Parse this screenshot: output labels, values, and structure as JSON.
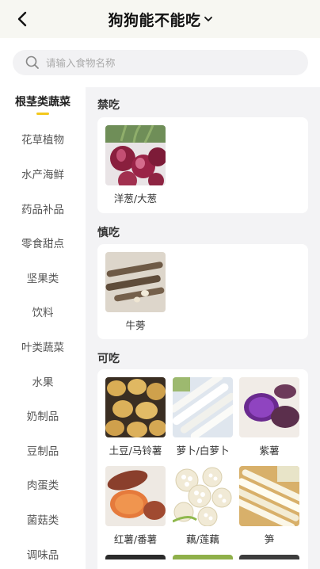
{
  "header": {
    "title": "狗狗能不能吃"
  },
  "search": {
    "placeholder": "请输入食物名称"
  },
  "sidebar": {
    "items": [
      {
        "label": "根茎类蔬菜",
        "active": true
      },
      {
        "label": "花草植物"
      },
      {
        "label": "水产海鲜"
      },
      {
        "label": "药品补品"
      },
      {
        "label": "零食甜点"
      },
      {
        "label": "坚果类"
      },
      {
        "label": "饮料"
      },
      {
        "label": "叶类蔬菜"
      },
      {
        "label": "水果"
      },
      {
        "label": "奶制品"
      },
      {
        "label": "豆制品"
      },
      {
        "label": "肉蛋类"
      },
      {
        "label": "菌菇类"
      },
      {
        "label": "调味品"
      }
    ]
  },
  "sections": {
    "forbidden": {
      "title": "禁吃",
      "foods": [
        {
          "name": "洋葱/大葱",
          "icon": "onion-image"
        }
      ]
    },
    "caution": {
      "title": "慎吃",
      "foods": [
        {
          "name": "牛蒡",
          "icon": "burdock-image"
        }
      ]
    },
    "edible": {
      "title": "可吃",
      "foods": [
        {
          "name": "土豆/马铃薯",
          "icon": "potato-image"
        },
        {
          "name": "萝卜/白萝卜",
          "icon": "radish-image"
        },
        {
          "name": "紫薯",
          "icon": "purple-sweet-potato-image"
        },
        {
          "name": "红薯/番薯",
          "icon": "sweet-potato-image"
        },
        {
          "name": "藕/莲藕",
          "icon": "lotus-root-image"
        },
        {
          "name": "笋",
          "icon": "bamboo-shoot-image"
        }
      ]
    }
  },
  "colors": {
    "accent": "#f3c81c",
    "header_bg": "#f7f7f2",
    "content_bg": "#f3f3f5"
  }
}
